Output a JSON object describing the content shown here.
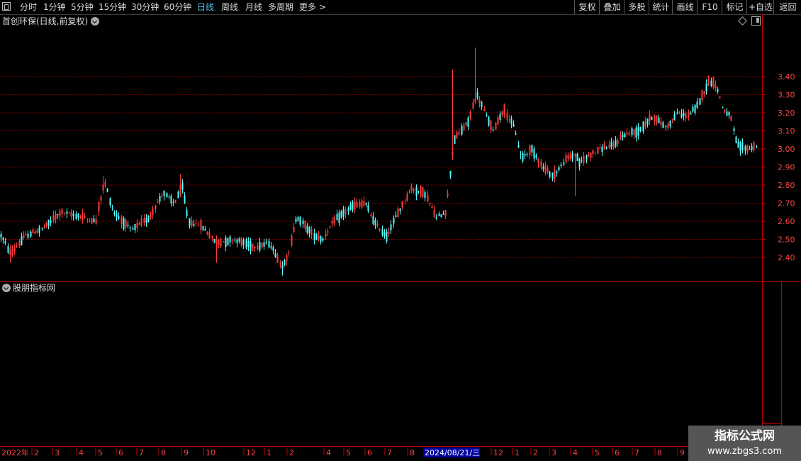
{
  "toolbar": {
    "periods": [
      "分时",
      "1分钟",
      "5分钟",
      "15分钟",
      "30分钟",
      "60分钟",
      "日线",
      "周线",
      "月线",
      "多周期",
      "更多 >"
    ],
    "active_period": "日线",
    "right_buttons": [
      "复权",
      "叠加",
      "多股",
      "统计",
      "画线",
      "F10",
      "标记",
      "+自选",
      "返回"
    ]
  },
  "chart": {
    "title": "首创环保(日线,前复权)",
    "indicator_title": "股朋指标网",
    "up_color": "#ff3c3c",
    "down_color": "#54fcfc",
    "grid_color": "#8b0000",
    "price_ticks": [
      "3.40",
      "3.30",
      "3.20",
      "3.10",
      "3.00",
      "2.90",
      "2.80",
      "2.70",
      "2.60",
      "2.50",
      "2.40"
    ],
    "date_labels": [
      "2022年",
      "2",
      "3",
      "4",
      "5",
      "6",
      "7",
      "8",
      "9",
      "10",
      "12",
      "1",
      "2",
      "4",
      "5",
      "6",
      "7",
      "8",
      "2024/08/21/三",
      "12",
      "1",
      "2",
      "3",
      "4",
      "5",
      "6",
      "7",
      "8",
      "9"
    ],
    "highlighted_date": "2024/08/21/三"
  },
  "watermark": {
    "line1": "指标公式网",
    "line2": "www.zbgs3.com"
  }
}
